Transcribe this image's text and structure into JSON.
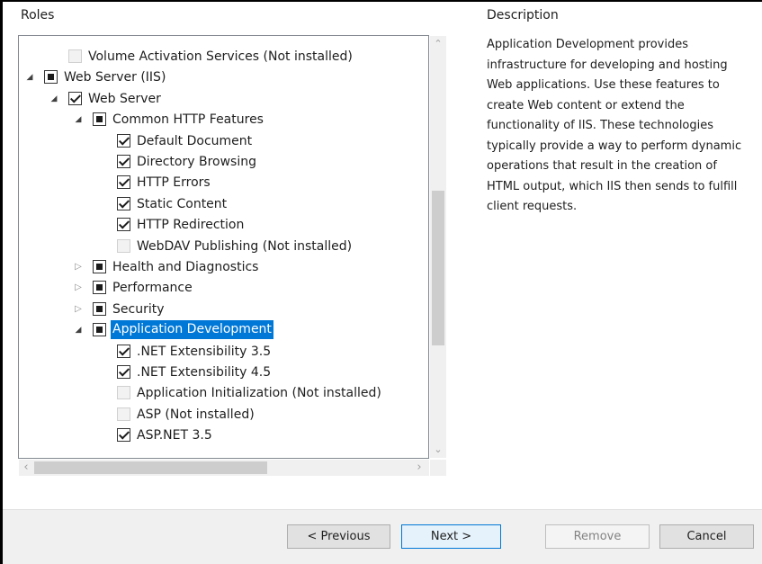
{
  "headers": {
    "roles": "Roles",
    "description": "Description"
  },
  "tree": [
    {
      "label": "Volume Activation Services (Not installed)",
      "state": "disabled",
      "expander": ""
    },
    {
      "label": "Web Server (IIS)",
      "state": "partial",
      "expander": "expanded"
    },
    {
      "label": "Web Server",
      "state": "checked",
      "expander": "expanded"
    },
    {
      "label": "Common HTTP Features",
      "state": "partial",
      "expander": "expanded"
    },
    {
      "label": "Default Document",
      "state": "checked",
      "expander": ""
    },
    {
      "label": "Directory Browsing",
      "state": "checked",
      "expander": ""
    },
    {
      "label": "HTTP Errors",
      "state": "checked",
      "expander": ""
    },
    {
      "label": "Static Content",
      "state": "checked",
      "expander": ""
    },
    {
      "label": "HTTP Redirection",
      "state": "checked",
      "expander": ""
    },
    {
      "label": "WebDAV Publishing (Not installed)",
      "state": "disabled",
      "expander": ""
    },
    {
      "label": "Health and Diagnostics",
      "state": "partial",
      "expander": "collapsed"
    },
    {
      "label": "Performance",
      "state": "partial",
      "expander": "collapsed"
    },
    {
      "label": "Security",
      "state": "partial",
      "expander": "collapsed"
    },
    {
      "label": "Application Development",
      "state": "partial",
      "expander": "expanded",
      "selected": true
    },
    {
      "label": ".NET Extensibility 3.5",
      "state": "checked",
      "expander": ""
    },
    {
      "label": ".NET Extensibility 4.5",
      "state": "checked",
      "expander": ""
    },
    {
      "label": "Application Initialization (Not installed)",
      "state": "disabled",
      "expander": ""
    },
    {
      "label": "ASP (Not installed)",
      "state": "disabled",
      "expander": ""
    },
    {
      "label": "ASP.NET 3.5",
      "state": "checked",
      "expander": ""
    }
  ],
  "description_text": "Application Development provides infrastructure for developing and hosting Web applications. Use these features to create Web content or extend the functionality of IIS. These technologies typically provide a way to perform dynamic operations that result in the creation of HTML output, which IIS then sends to fulfill client requests.",
  "buttons": {
    "previous": "< Previous",
    "next": "Next >",
    "remove": "Remove",
    "cancel": "Cancel"
  },
  "colors": {
    "selection": "#0078d7",
    "footer_bg": "#f0f0f0"
  }
}
